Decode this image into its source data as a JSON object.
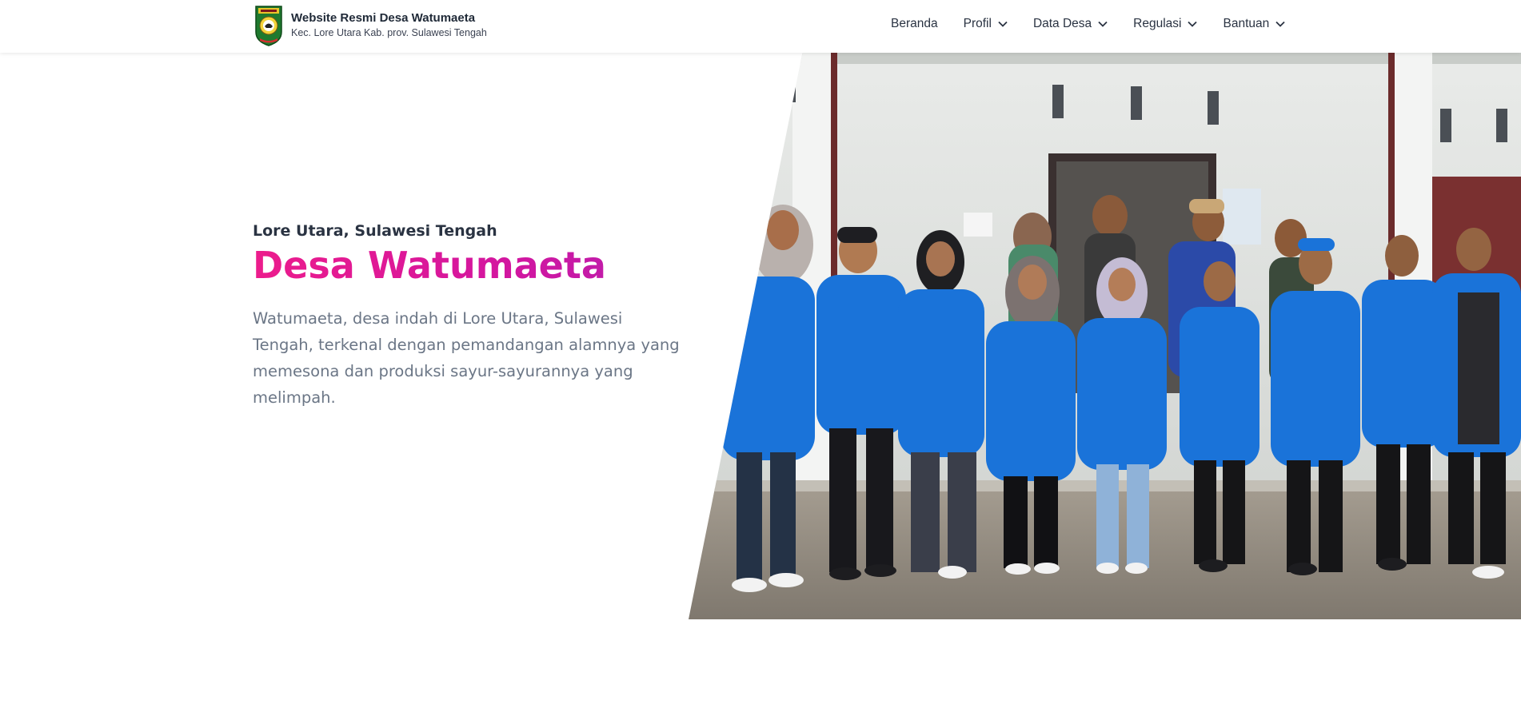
{
  "header": {
    "site_title": "Website Resmi Desa Watumaeta",
    "site_subtitle": "Kec. Lore Utara Kab. prov. Sulawesi Tengah",
    "nav": [
      {
        "label": "Beranda",
        "dropdown": false
      },
      {
        "label": "Profil",
        "dropdown": true
      },
      {
        "label": "Data Desa",
        "dropdown": true
      },
      {
        "label": "Regulasi",
        "dropdown": true
      },
      {
        "label": "Bantuan",
        "dropdown": true
      }
    ]
  },
  "hero": {
    "eyebrow": "Lore Utara, Sulawesi Tengah",
    "title": "Desa Watumaeta",
    "description": "Watumaeta, desa indah di Lore Utara, Sulawesi Tengah, terkenal dengan pemandangan alamnya yang memesona dan produksi sayur-sayurannya yang melimpah."
  },
  "colors": {
    "title_gradient_start": "#ec1c8c",
    "title_gradient_end": "#b51fb0",
    "text_dark": "#2a3342",
    "text_muted": "#6b7686",
    "jacket_blue": "#1a73d9"
  },
  "icons": {
    "logo": "regency-crest-logo",
    "dropdown": "chevron-down-icon"
  }
}
